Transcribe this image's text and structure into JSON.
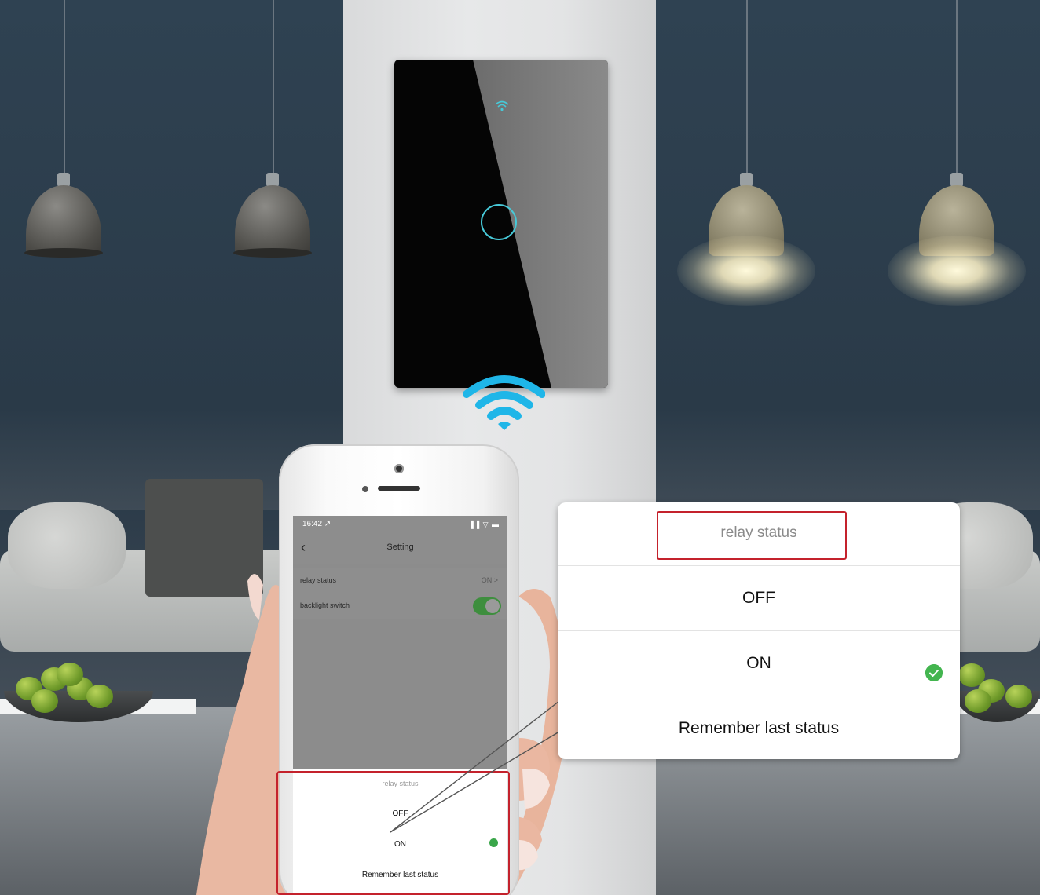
{
  "phone": {
    "status_time": "16:42 ↗",
    "status_icons": "▐▐ ▽ ▬",
    "nav_back_icon": "chevron-left-icon",
    "nav_title": "Setting",
    "rows": [
      {
        "label": "relay status",
        "value": "ON  >"
      },
      {
        "label": "backlight switch",
        "toggle_on": true
      }
    ],
    "sheet": {
      "header": "relay status",
      "options": [
        "OFF",
        "ON",
        "Remember last status"
      ],
      "selected": "ON"
    }
  },
  "callout": {
    "header": "relay status",
    "options": [
      "OFF",
      "ON",
      "Remember last status"
    ],
    "selected": "ON"
  },
  "colors": {
    "highlight_box": "#c4222c",
    "check_green": "#43b54f",
    "wifi_blue": "#1fb6e8"
  }
}
